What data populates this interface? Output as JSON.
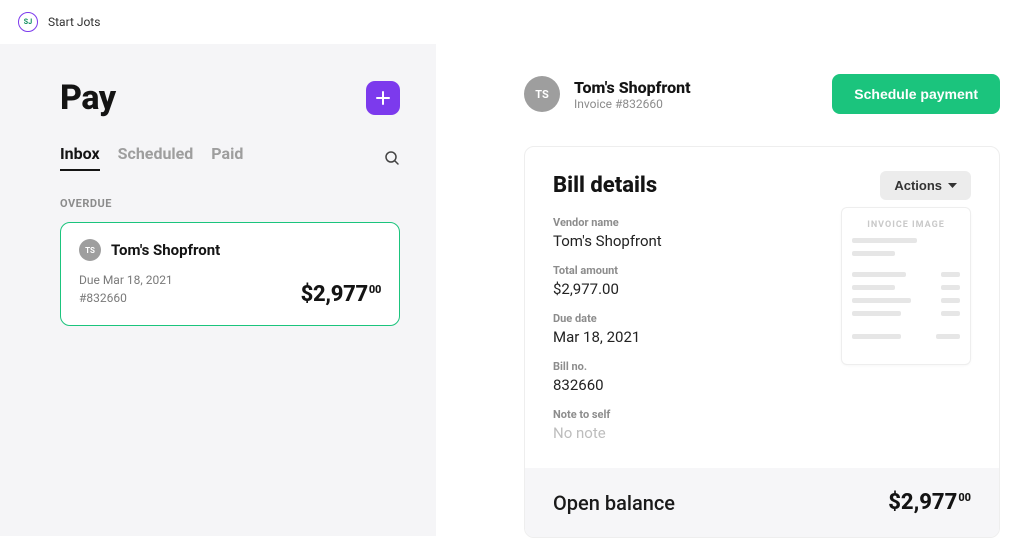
{
  "brand": {
    "initials": "SJ",
    "name": "Start Jots"
  },
  "left": {
    "title": "Pay",
    "tabs": {
      "inbox": "Inbox",
      "scheduled": "Scheduled",
      "paid": "Paid"
    },
    "section_label": "OVERDUE",
    "card": {
      "initials": "TS",
      "vendor": "Tom's Shopfront",
      "due_line": "Due Mar 18, 2021",
      "ref_line": "#832660",
      "amount_main": "$2,977",
      "amount_cents": "00"
    }
  },
  "right": {
    "header": {
      "initials": "TS",
      "vendor": "Tom's Shopfront",
      "subtitle": "Invoice #832660",
      "cta": "Schedule payment"
    },
    "detail": {
      "title": "Bill details",
      "actions_label": "Actions",
      "thumb_title": "INVOICE IMAGE",
      "fields": {
        "vendor_label": "Vendor name",
        "vendor_value": "Tom's Shopfront",
        "total_label": "Total amount",
        "total_value": "$2,977.00",
        "due_label": "Due date",
        "due_value": "Mar 18, 2021",
        "billno_label": "Bill no.",
        "billno_value": "832660",
        "note_label": "Note to self",
        "note_value": "No note"
      },
      "balance_label": "Open balance",
      "balance_main": "$2,977",
      "balance_cents": "00"
    }
  }
}
